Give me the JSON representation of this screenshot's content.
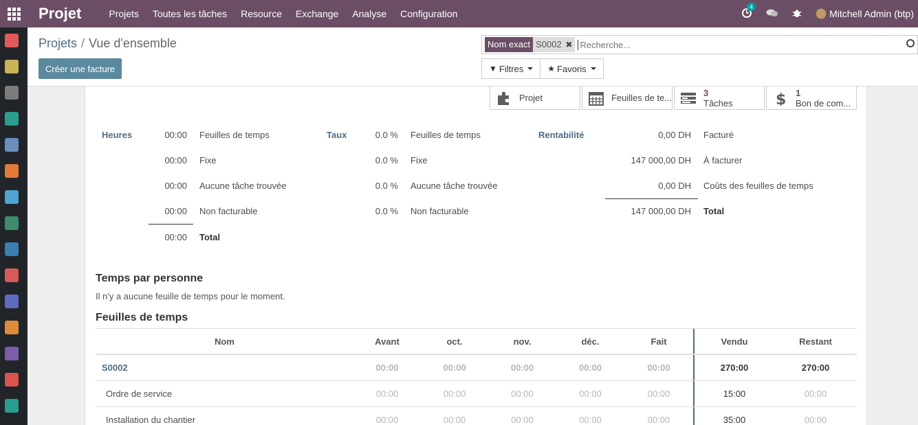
{
  "app": {
    "brand": "Projet",
    "menu": [
      "Projets",
      "Toutes les tâches",
      "Resource",
      "Exchange",
      "Analyse",
      "Configuration"
    ],
    "activity_count": "4",
    "user_name": "Mitchell Admin (btp)"
  },
  "breadcrumb": {
    "parent": "Projets",
    "separator": "/",
    "current": "Vue d'ensemble"
  },
  "create_invoice_label": "Créer une facture",
  "search": {
    "facet_label": "Nom exact",
    "facet_value": "S0002",
    "placeholder": "Recherche..."
  },
  "filters_label": "Filtres",
  "favorites_label": "Favoris",
  "stat_buttons": {
    "projet": {
      "label": "Projet"
    },
    "feuilles": {
      "label": "Feuilles de te..."
    },
    "taches": {
      "count": "3",
      "label": "Tâches"
    },
    "bon": {
      "count": "1",
      "label": "Bon de com..."
    }
  },
  "heures": {
    "title": "Heures",
    "rows": [
      {
        "value": "00:00",
        "label": "Feuilles de temps"
      },
      {
        "value": "00:00",
        "label": "Fixe"
      },
      {
        "value": "00:00",
        "label": "Aucune tâche trouvée"
      },
      {
        "value": "00:00",
        "label": "Non facturable"
      }
    ],
    "total_value": "00:00",
    "total_label": "Total"
  },
  "taux": {
    "title": "Taux",
    "rows": [
      {
        "value": "0.0 %",
        "label": "Feuilles de temps"
      },
      {
        "value": "0.0 %",
        "label": "Fixe"
      },
      {
        "value": "0.0 %",
        "label": "Aucune tâche trouvée"
      },
      {
        "value": "0.0 %",
        "label": "Non facturable"
      }
    ]
  },
  "rentabilite": {
    "title": "Rentabilité",
    "rows": [
      {
        "value": "0,00 DH",
        "label": "Facturé"
      },
      {
        "value": "147 000,00 DH",
        "label": "À facturer"
      },
      {
        "value": "0,00 DH",
        "label": "Coûts des feuilles de temps"
      }
    ],
    "total_value": "147 000,00 DH",
    "total_label": "Total"
  },
  "temps_par_personne": {
    "title": "Temps par personne",
    "empty_text": "Il n'y a aucune feuille de temps pour le moment."
  },
  "feuilles_de_temps": {
    "title": "Feuilles de temps",
    "columns": [
      "Nom",
      "Avant",
      "oct.",
      "nov.",
      "déc.",
      "Fait",
      "Vendu",
      "Restant"
    ],
    "rows": [
      {
        "name": "S0002",
        "cells": [
          "00:00",
          "00:00",
          "00:00",
          "00:00",
          "00:00",
          "270:00",
          "270:00"
        ]
      },
      {
        "name": "Ordre de service",
        "cells": [
          "00:00",
          "00:00",
          "00:00",
          "00:00",
          "00:00",
          "15:00",
          "00:00"
        ]
      },
      {
        "name": "Installation du chantier",
        "cells": [
          "00:00",
          "00:00",
          "00:00",
          "00:00",
          "00:00",
          "35:00",
          "00:00"
        ]
      }
    ]
  },
  "colors": {
    "navbar": "#6b4e66",
    "accent": "#4c6d84",
    "button": "#5b899e",
    "sidebar": "#212529"
  }
}
